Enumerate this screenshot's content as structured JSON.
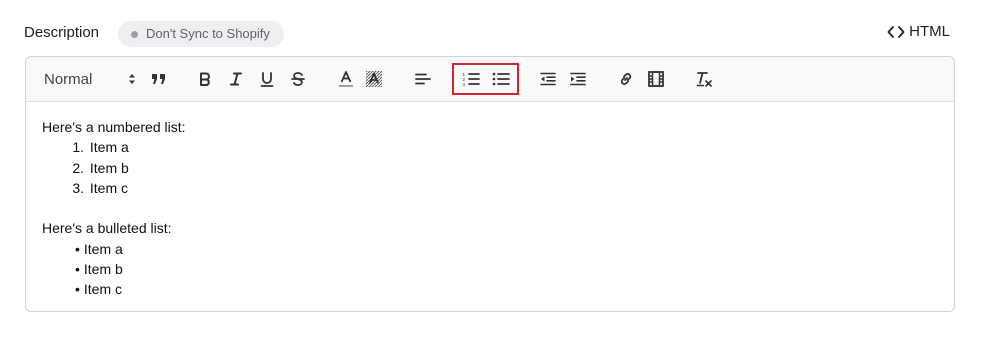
{
  "header": {
    "title": "Description",
    "sync_badge": "Don't Sync to Shopify",
    "html_toggle": "HTML"
  },
  "toolbar": {
    "format_select": "Normal",
    "buttons": [
      "blockquote",
      "bold",
      "italic",
      "underline",
      "strikethrough",
      "text-color",
      "background-color",
      "align",
      "ordered-list",
      "bullet-list",
      "outdent",
      "indent",
      "link",
      "video",
      "clear-formatting"
    ],
    "highlighted_group": [
      "ordered-list",
      "bullet-list"
    ],
    "highlight_color": "#d1242f"
  },
  "content": {
    "numbered_intro": "Here's a numbered list:",
    "numbered_items": [
      {
        "num": "1.",
        "text": "Item a"
      },
      {
        "num": "2.",
        "text": "Item b"
      },
      {
        "num": "3.",
        "text": "Item c"
      }
    ],
    "bulleted_intro": "Here's a bulleted list:",
    "bulleted_items": [
      "Item a",
      "Item b",
      "Item c"
    ]
  }
}
